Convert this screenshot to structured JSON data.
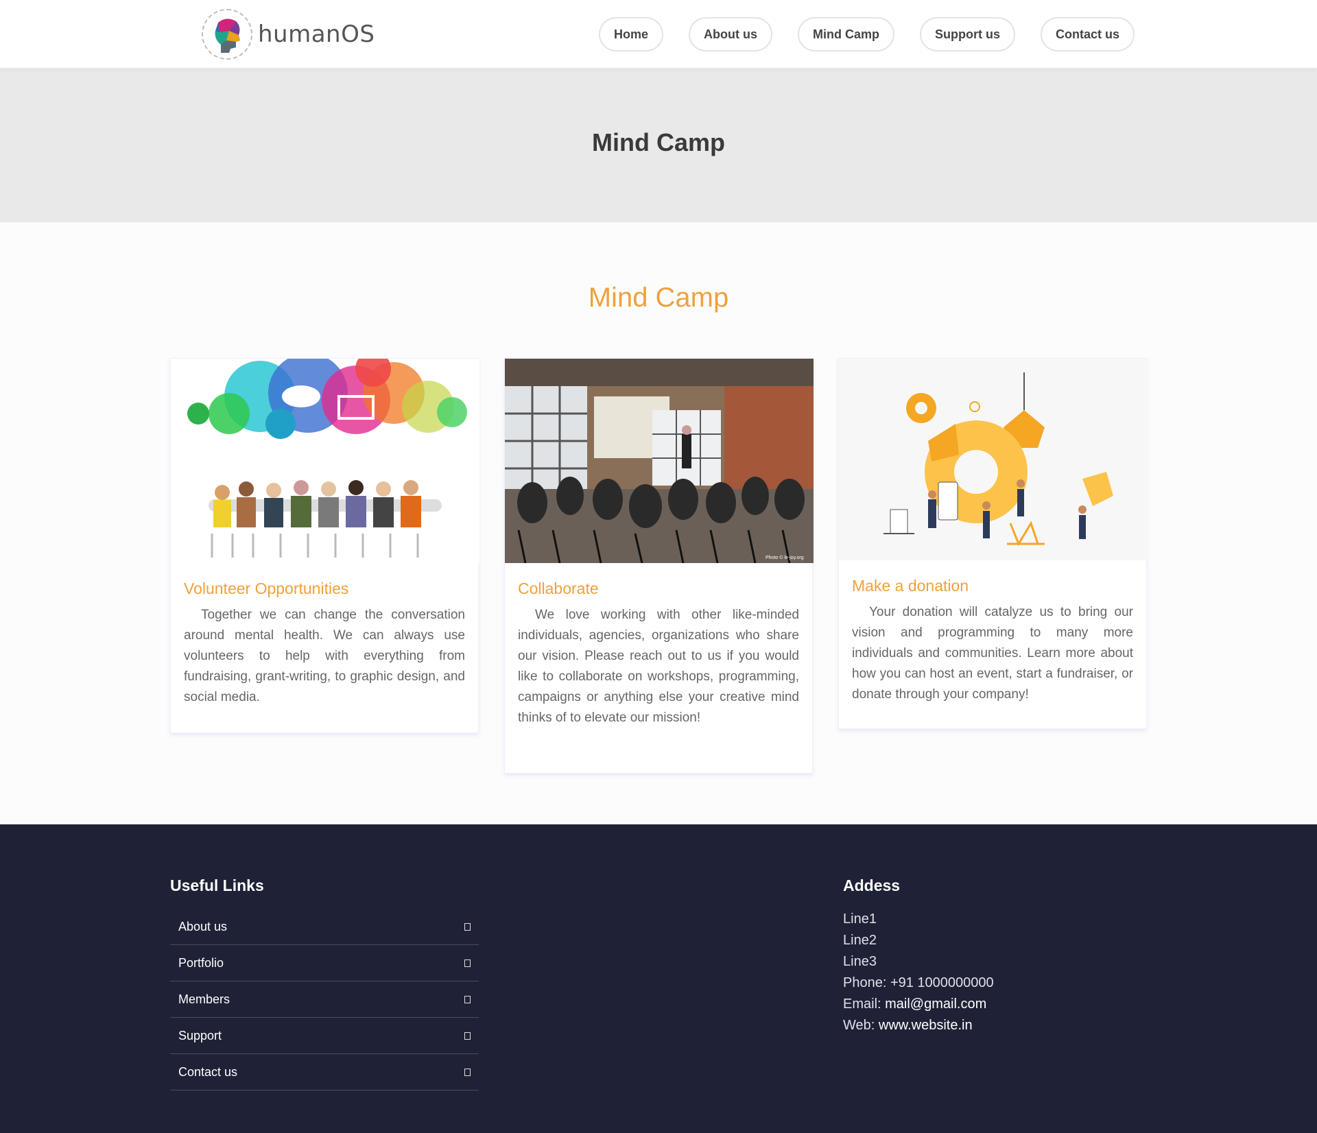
{
  "brand": {
    "name": "humanOS"
  },
  "nav": [
    "Home",
    "About us",
    "Mind Camp",
    "Support us",
    "Contact us"
  ],
  "page_title": "Mind Camp",
  "section_title": "Mind Camp",
  "cards": [
    {
      "title": "Volunteer Opportunities",
      "text": "Together we can change the conversation around mental health. We can always use volunteers to help with everything from fundraising, grant-writing, to graphic design, and social media."
    },
    {
      "title": "Collaborate",
      "text": "We love working with other like-minded individuals, agencies, organizations who share our vision. Please reach out to us if you would like to collaborate on workshops, programming, campaigns or anything else your creative mind thinks of to elevate our mission!",
      "photo_credit": "Photo © le-joy.org"
    },
    {
      "title": "Make a donation",
      "text": "Your donation will catalyze us to bring our vision and programming to many more individuals and communities. Learn more about how you can host an event, start a fundraiser, or donate through your company!"
    }
  ],
  "footer": {
    "links_title": "Useful Links",
    "links": [
      "About us",
      "Portfolio",
      "Members",
      "Support",
      "Contact us"
    ],
    "address_title": "Addess",
    "address_lines": [
      "Line1",
      "Line2",
      "Line3"
    ],
    "phone_label": "Phone:",
    "phone": "+91 1000000000",
    "email_label": "Email:",
    "email": "mail@gmail.com",
    "web_label": "Web:",
    "web": "www.website.in"
  }
}
